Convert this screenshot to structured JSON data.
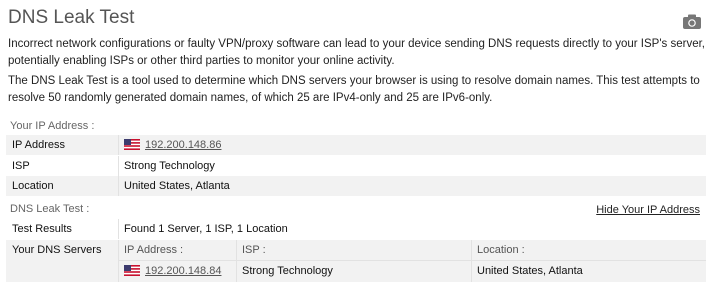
{
  "header": {
    "title": "DNS Leak Test",
    "camera_icon": "camera-icon"
  },
  "intro": {
    "p1": "Incorrect network configurations or faulty VPN/proxy software can lead to your device sending DNS requests directly to your ISP's server, potentially enabling ISPs or other third parties to monitor your online activity.",
    "p2": "The DNS Leak Test is a tool used to determine which DNS servers your browser is using to resolve domain names. This test attempts to resolve 50 randomly generated domain names, of which 25 are IPv4-only and 25 are IPv6-only."
  },
  "ip_section": {
    "label": "Your IP Address :",
    "rows": [
      {
        "label": "IP Address",
        "value": "192.200.148.86"
      },
      {
        "label": "ISP",
        "value": "Strong Technology"
      },
      {
        "label": "Location",
        "value": "United States, Atlanta"
      }
    ]
  },
  "dns_section": {
    "label": "DNS Leak Test :",
    "hide_link": "Hide Your IP Address",
    "results_label": "Test Results",
    "results_value": "Found 1 Server, 1 ISP, 1 Location",
    "servers_label": "Your DNS Servers",
    "columns": [
      "IP Address :",
      "ISP :",
      "Location :"
    ],
    "servers": [
      {
        "ip": "192.200.148.84",
        "isp": "Strong Technology",
        "location": "United States, Atlanta"
      }
    ]
  },
  "flag_icon": "us-flag-icon",
  "colors": {
    "row_bg": "#f2f2f2",
    "title": "#555555"
  }
}
